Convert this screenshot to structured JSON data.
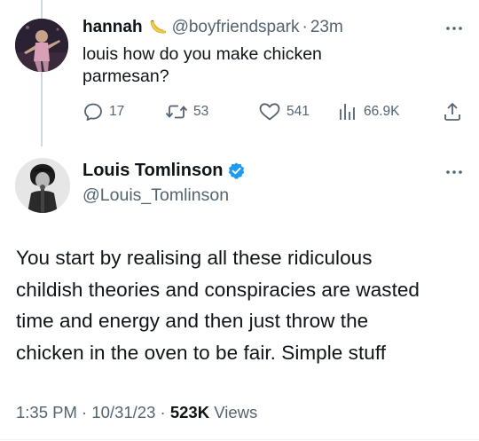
{
  "reply": {
    "name": "hannah",
    "name_emoji": "banana-icon",
    "handle": "@boyfriendspark",
    "separator": "·",
    "time": "23m",
    "text": "louis how do you make chicken parmesan?",
    "actions": {
      "replies": "17",
      "retweets": "53",
      "likes": "541",
      "views": "66.9K"
    }
  },
  "tweet": {
    "name": "Louis Tomlinson",
    "verified": true,
    "handle": "@Louis_Tomlinson",
    "text_lines": [
      "You start by realising all these ridiculous",
      "childish theories and conspiracies are wasted",
      "time and energy and then just throw the",
      "chicken in the oven to be fair. Simple stuff"
    ],
    "time": "1:35 PM",
    "sep1": "·",
    "date": "10/31/23",
    "sep2": "·",
    "views_count": "523K",
    "views_label": "Views"
  },
  "colors": {
    "text": "#0f1419",
    "secondary": "#536471",
    "verified": "#1d9bf0",
    "thread_line": "#cfd9de"
  }
}
